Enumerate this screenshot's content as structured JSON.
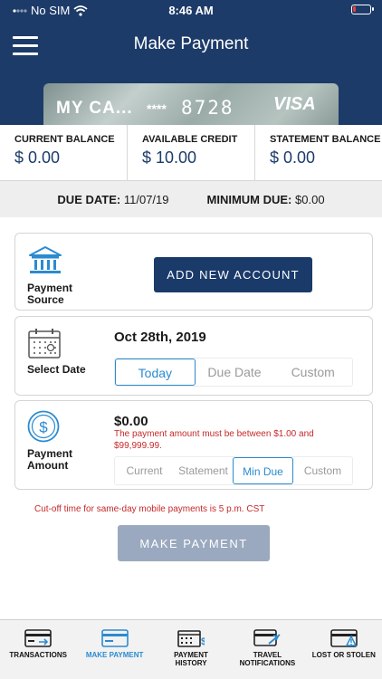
{
  "status_bar": {
    "carrier": "No SIM",
    "time": "8:46 AM"
  },
  "header": {
    "title": "Make Payment"
  },
  "card": {
    "name": "MY CA...",
    "masked": "****",
    "last_four": "8728",
    "brand": "VISA"
  },
  "balances": [
    {
      "label": "CURRENT BALANCE",
      "value": "$ 0.00"
    },
    {
      "label": "AVAILABLE CREDIT",
      "value": "$ 10.00"
    },
    {
      "label": "STATEMENT BALANCE",
      "value": "$ 0.00"
    }
  ],
  "due": {
    "due_date_label": "DUE DATE:",
    "due_date": "11/07/19",
    "min_due_label": "MINIMUM DUE:",
    "min_due": "$0.00"
  },
  "payment_source": {
    "label_line1": "Payment",
    "label_line2": "Source",
    "button": "ADD NEW ACCOUNT"
  },
  "select_date": {
    "label": "Select Date",
    "date": "Oct 28th, 2019",
    "options": [
      "Today",
      "Due Date",
      "Custom"
    ],
    "selected": "Today"
  },
  "payment_amount": {
    "label_line1": "Payment",
    "label_line2": "Amount",
    "amount": "$0.00",
    "error": "The payment amount must be between $1.00 and $99,999.99.",
    "options": [
      "Current",
      "Statement",
      "Min Due",
      "Custom"
    ],
    "selected": "Min Due"
  },
  "cutoff_note": "Cut-off time for same-day mobile payments is 5 p.m. CST",
  "make_payment_button": "MAKE PAYMENT",
  "tabs": [
    {
      "line1": "TRANSACTIONS",
      "line2": "",
      "icon": "card-transfer-icon",
      "active": false
    },
    {
      "line1": "MAKE PAYMENT",
      "line2": "",
      "icon": "card-payment-icon",
      "active": true
    },
    {
      "line1": "PAYMENT",
      "line2": "HISTORY",
      "icon": "calendar-dollar-icon",
      "active": false
    },
    {
      "line1": "TRAVEL",
      "line2": "NOTIFICATIONS",
      "icon": "card-plane-icon",
      "active": false
    },
    {
      "line1": "LOST OR STOLEN",
      "line2": "",
      "icon": "card-warning-icon",
      "active": false
    }
  ],
  "colors": {
    "navy": "#1d3b69",
    "accent": "#2a8bd0",
    "error": "#c62828",
    "disabled": "#9aa9bf"
  }
}
